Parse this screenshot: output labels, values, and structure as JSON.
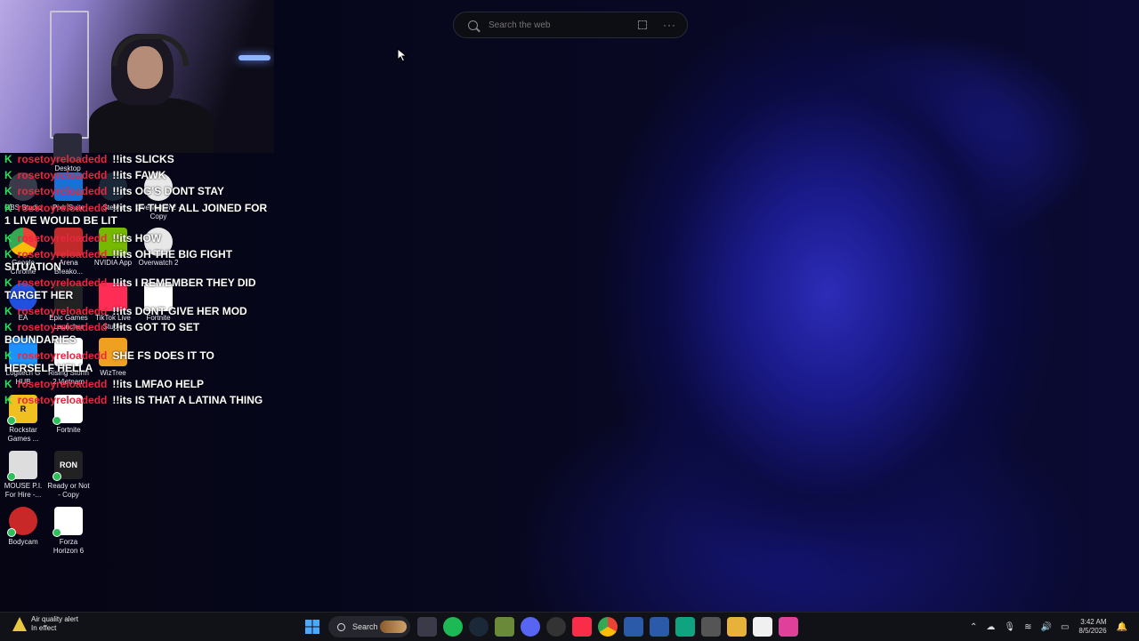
{
  "search": {
    "placeholder": "Search the web"
  },
  "desktop_icons": [
    {
      "label": "Desktop",
      "color": "#2a2a3a"
    },
    {
      "label": "OBS Studio",
      "color": "#3a3a4a"
    },
    {
      "label": "Pixlr Suite",
      "color": "#1a6fd8"
    },
    {
      "label": "Steam",
      "color": "#1b2838"
    },
    {
      "label": "Overwatch 2 - Copy",
      "color": "#e8e8e8"
    },
    {
      "label": "Google Chrome",
      "color": "#ffffff"
    },
    {
      "label": "Arena Breako...",
      "color": "#c02a2a"
    },
    {
      "label": "NVIDIA App",
      "color": "#76b900"
    },
    {
      "label": "Overwatch 2",
      "color": "#e8e8e8"
    },
    {
      "label": "EA",
      "color": "#2050e0"
    },
    {
      "label": "Epic Games Launcher",
      "color": "#222222"
    },
    {
      "label": "TikTok Live Studio",
      "color": "#ff2c55"
    },
    {
      "label": "Fortnite",
      "color": "#ffffff"
    },
    {
      "label": "Logitech G HUB",
      "color": "#1e90ff"
    },
    {
      "label": "Rising Storm 2 Vietnam",
      "color": "#ffffff"
    },
    {
      "label": "WizTree",
      "color": "#f0a020"
    },
    {
      "label": "Rockstar Games ...",
      "color": "#f0c020"
    },
    {
      "label": "Fortnite",
      "color": "#ffffff"
    },
    {
      "label": "MOUSE P.I. For Hire -...",
      "color": "#dddddd"
    },
    {
      "label": "Ready or Not - Copy",
      "color": "#222222"
    },
    {
      "label": "Bodycam",
      "color": "#c82828"
    },
    {
      "label": "Forza Horizon 6",
      "color": "#ffffff"
    }
  ],
  "chat": {
    "user": "rosetoyreloadedd",
    "messages": [
      {
        "text": "!!its SLICKS"
      },
      {
        "text": "!!its FAWK"
      },
      {
        "text": "!!its OG'S DONT STAY"
      },
      {
        "text": "!!its IF THEY ALL JOINED FOR"
      },
      {
        "text": "1 LIVE WOULD BE LIT"
      },
      {
        "text": "!!its HOW"
      },
      {
        "text": "!!its OH THE BIG FIGHT"
      },
      {
        "text": "SITUATION"
      },
      {
        "text": "TARGET HER"
      },
      {
        "text": "!!its I REMEMBER THEY DID"
      },
      {
        "text": "!!its DONT GIVE HER MOD"
      },
      {
        "text": "!!its GOT TO SET"
      },
      {
        "text": "BOUNDARIES"
      },
      {
        "text": "SHE FS DOES IT TO"
      },
      {
        "text": "HERSELF HELLA"
      },
      {
        "text": "!!its LMFAO HELP"
      },
      {
        "text": "!!its IS THAT A LATINA THING"
      }
    ]
  },
  "taskbar": {
    "weather_title": "Air quality alert",
    "weather_sub": "In effect",
    "search_label": "Search",
    "time": "3:42 AM",
    "date": "8/5/2026"
  }
}
